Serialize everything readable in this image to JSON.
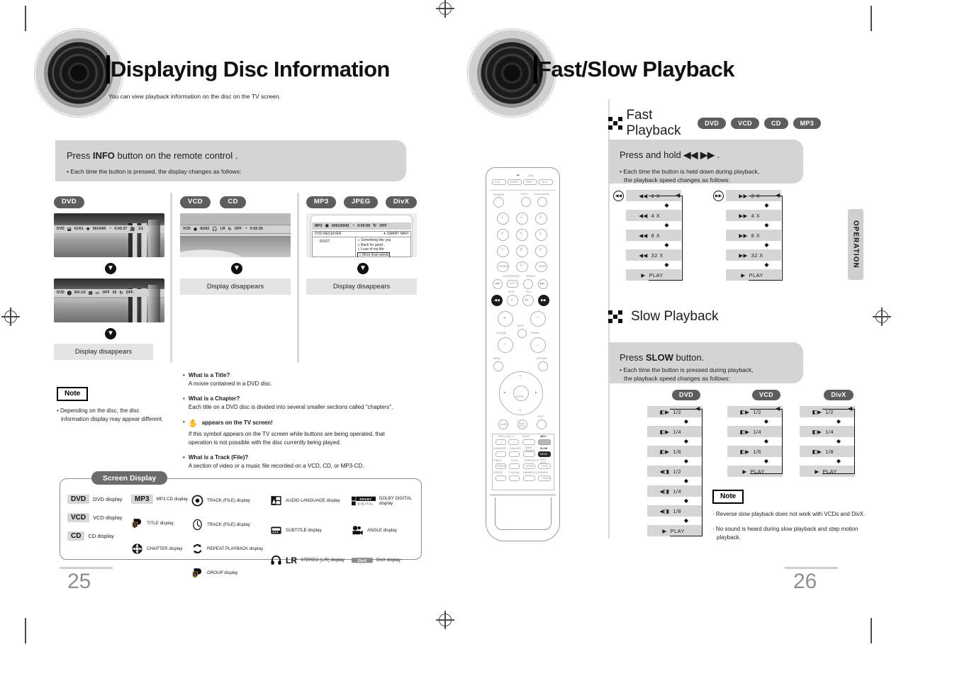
{
  "document": {
    "left_page": {
      "page_number": "25",
      "title": "Displaying Disc Information",
      "subtitle": "You can view playback information on the disc on the TV screen.",
      "instruction": {
        "head_prefix": "Press ",
        "head_bold": "INFO",
        "head_suffix": " button on the remote control .",
        "bullet": "• Each time the button is pressed, the display changes as follows:"
      },
      "columns": [
        {
          "badges": [
            "DVD"
          ],
          "screens": [
            {
              "osd": [
                "DVD",
                "01/01",
                "001/040",
                "0:00:37",
                "1/1"
              ]
            },
            {
              "osd": [
                "DVD",
                "EN 1/3",
                "OFF",
                "02",
                "OFF"
              ]
            }
          ],
          "end_label": "Display disappears"
        },
        {
          "badges": [
            "VCD",
            "CD"
          ],
          "screens": [
            {
              "osd": [
                "VCD",
                "02/02",
                "LR",
                "OFF",
                "0:02:30"
              ]
            }
          ],
          "end_label": "Display disappears"
        },
        {
          "badges": [
            "MP3",
            "JPEG",
            "DivX"
          ],
          "screens": [
            {
              "osd": [
                "MP3",
                "0001/0042",
                "0:00:09",
                "OFF"
              ],
              "menu_title": "DVD RECEIVER",
              "menu_right": "SMART NAVI",
              "menu_root": "ROOT",
              "tracks": [
                "Something like you",
                "Back for good",
                "Love of my life",
                "More than words"
              ]
            }
          ],
          "end_label": "Display disappears"
        }
      ],
      "note": {
        "label": "Note",
        "lines": [
          "• Depending on the disc, the disc",
          "information display may appear different."
        ]
      },
      "faq": [
        {
          "q": "What is a Title?",
          "a": [
            "A movie contained in a DVD disc."
          ]
        },
        {
          "q": "What is a Chapter?",
          "a": [
            "Each title on a DVD disc is divided into several smaller sections called \"chapters\"."
          ]
        },
        {
          "q": "appears on the TV screen!",
          "icon": "hand-icon",
          "a": [
            "If this symbol appears on the TV screen while buttons are being operated, that",
            "operation is not possible with the disc currently being played."
          ]
        },
        {
          "q": "What is a Track (File)?",
          "a": [
            "A section of video or a music file recorded on a VCD, CD, or MP3-CD."
          ]
        }
      ],
      "legend": {
        "title": "Screen Display",
        "items": [
          {
            "icon": "chip-dvd",
            "chip": "DVD",
            "label": "DVD display",
            "size": "big"
          },
          {
            "icon": "chip-vcd",
            "chip": "VCD",
            "label": "VCD display",
            "size": "big"
          },
          {
            "icon": "chip-cd",
            "chip": "CD",
            "label": "CD display",
            "size": "big"
          },
          {
            "icon": "chip-mp3",
            "chip": "MP3",
            "label": "MP3 CD display",
            "size": "small"
          },
          {
            "icon": "title-icon",
            "chip": "",
            "label": "TITLE display",
            "size": "small"
          },
          {
            "icon": "chapter-icon",
            "chip": "",
            "label": "CHAPTER display",
            "size": "small"
          },
          {
            "icon": "track-disc-icon",
            "chip": "",
            "label": "TRACK (FILE) display",
            "size": "small"
          },
          {
            "icon": "track-clock-icon",
            "chip": "",
            "label": "TRACK (FILE) display",
            "size": "small"
          },
          {
            "icon": "repeat-icon",
            "chip": "",
            "label": "REPEAT PLAYBACK display",
            "size": "small"
          },
          {
            "icon": "group-icon",
            "chip": "",
            "label": "GROUP display",
            "size": "small"
          },
          {
            "icon": "audio-lang-icon",
            "chip": "",
            "label": "AUDIO LANGUAGE display",
            "size": "small"
          },
          {
            "icon": "subtitle-icon",
            "chip": "",
            "label": "SUBTITLE display",
            "size": "small"
          },
          {
            "icon": "stereo-icon",
            "chip": "LR",
            "label": "STEREO (L/R) display",
            "size": "small"
          },
          {
            "icon": "dolby-icon",
            "chip": "",
            "label": "DOLBY DIGITAL display",
            "size": "small"
          },
          {
            "icon": "angle-icon",
            "chip": "",
            "label": "ANGLE display",
            "size": "small"
          },
          {
            "icon": "divx-icon",
            "chip": "",
            "label": "DivX display",
            "size": "small"
          }
        ]
      }
    },
    "right_page": {
      "page_number": "26",
      "title": "Fast/Slow Playback",
      "side_tab": "OPERATION",
      "fast": {
        "heading": "Fast Playback",
        "badges": [
          "DVD",
          "VCD",
          "CD",
          "MP3"
        ],
        "instruction": {
          "head_prefix": "Press and hold ",
          "head_icons": "◀◀ ▶▶",
          "head_suffix": " .",
          "bullet_line1": "• Each time the button is held down during playback,",
          "bullet_line2": "the playback speed changes as follows:"
        },
        "flows": [
          {
            "button": "rewind-button",
            "glyph": "◀◀",
            "steps": [
              "2 X",
              "4 X",
              "8 X",
              "32 X"
            ],
            "play": "PLAY",
            "step_glyph": "◀◀"
          },
          {
            "button": "forward-button",
            "glyph": "▶▶",
            "steps": [
              "2 X",
              "4 X",
              "8 X",
              "32 X"
            ],
            "play": "PLAY",
            "step_glyph": "▶▶"
          }
        ]
      },
      "slow": {
        "heading": "Slow Playback",
        "instruction": {
          "head_prefix": "Press  ",
          "head_bold": "SLOW",
          "head_suffix": " button.",
          "bullet_line1": "• Each time the button is pressed during playback,",
          "bullet_line2": "the playback speed changes as follows:"
        },
        "flows": [
          {
            "badge": "DVD",
            "steps": [
              {
                "glyph": "◧▶",
                "label": "1/2"
              },
              {
                "glyph": "◧▶",
                "label": "1/4"
              },
              {
                "glyph": "◧▶",
                "label": "1/8"
              },
              {
                "glyph": "◀◨",
                "label": "1/2"
              },
              {
                "glyph": "◀◨",
                "label": "1/4"
              },
              {
                "glyph": "◀◨",
                "label": "1/8"
              }
            ],
            "play": "PLAY"
          },
          {
            "badge": "VCD",
            "steps": [
              {
                "glyph": "◧▶",
                "label": "1/2"
              },
              {
                "glyph": "◧▶",
                "label": "1/4"
              },
              {
                "glyph": "◧▶",
                "label": "1/6"
              }
            ],
            "play": "PLAY"
          },
          {
            "badge": "DivX",
            "steps": [
              {
                "glyph": "◧▶",
                "label": "1/2"
              },
              {
                "glyph": "◧▶",
                "label": "1/4"
              },
              {
                "glyph": "◧▶",
                "label": "1/8"
              }
            ],
            "play": "PLAY"
          }
        ],
        "note": {
          "label": "Note",
          "lines": [
            "· Reverse slow playback does not work with VCDs and DivX.",
            "· No sound is heard during slow playback and step motion",
            "playback."
          ]
        }
      }
    },
    "remote": {
      "name": "dvd-remote-control",
      "source_row": [
        "DVD",
        "TUNER",
        "TAPE",
        "AUX"
      ],
      "source_row_top": "USB",
      "labels": {
        "power": "POWER",
        "eject": "EJECT",
        "dvd_receiver": "DVD RECEIVER",
        "clear": "REMAIN",
        "mode": "MODE",
        "cdrep": "COVER/RESET",
        "repeat": "REPEAT",
        "stop": "STOP",
        "play": "PLAY",
        "volume": "VOLUME",
        "mute": "MUTE",
        "tuning": "TUNING",
        "menu": "MENU",
        "return": "RETURN",
        "enter": "ENTER",
        "audio": "AUDIO",
        "subtitle": "SUBTITLE",
        "exit": "EXIT",
        "info": "INFO",
        "slow": "SLOW",
        "sleep": "SLEEP",
        "logo": "LOGO",
        "timer": "TIMER"
      },
      "numbers": [
        "1",
        "2",
        "3",
        "4",
        "5",
        "6",
        "7",
        "8",
        "9",
        "0"
      ]
    }
  },
  "colors": {
    "badge_gray": "#5d5d5d",
    "panel_gray": "#d4d4d4",
    "step_gray": "#d6d6d6",
    "page_num": "#8f8f8f",
    "tab_gray": "#cfcfcf"
  }
}
